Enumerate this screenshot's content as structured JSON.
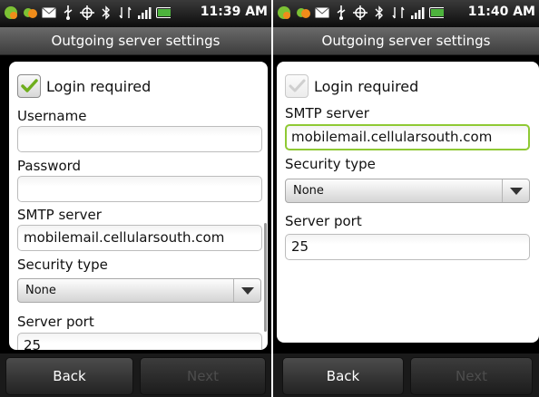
{
  "screens": [
    {
      "status_time": "11:39 AM",
      "title": "Outgoing server settings",
      "login_required_label": "Login required",
      "login_required_checked": true,
      "username_label": "Username",
      "username_value": "",
      "password_label": "Password",
      "password_value": "",
      "smtp_label": "SMTP server",
      "smtp_value": "mobilemail.cellularsouth.com",
      "security_label": "Security type",
      "security_value": "None",
      "port_label": "Server port",
      "port_value": "25",
      "back_label": "Back",
      "next_label": "Next"
    },
    {
      "status_time": "11:40 AM",
      "title": "Outgoing server settings",
      "login_required_label": "Login required",
      "login_required_checked": false,
      "smtp_label": "SMTP server",
      "smtp_value": "mobilemail.cellularsouth.com",
      "security_label": "Security type",
      "security_value": "None",
      "port_label": "Server port",
      "port_value": "25",
      "back_label": "Back",
      "next_label": "Next"
    }
  ],
  "status_icons": [
    "app-badge-icon",
    "notification-badge-icon",
    "mail-icon",
    "usb-icon",
    "gps-icon",
    "bluetooth-icon",
    "data-ev-icon",
    "signal-icon",
    "battery-icon"
  ],
  "colors": {
    "focus_border": "#8fc934",
    "checkmark": "#6fae1d",
    "checkmark_disabled": "#cfcfcf",
    "title_bar": "#4f4f4f",
    "status_bar": "#1e1e1e",
    "disabled_text": "#4d4d4d"
  }
}
